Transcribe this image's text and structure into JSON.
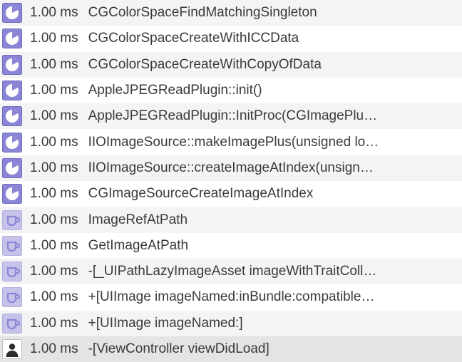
{
  "rows": [
    {
      "icon": "pie",
      "time": "1.00 ms",
      "symbol": "CGColorSpaceFindMatchingSingleton"
    },
    {
      "icon": "pie",
      "time": "1.00 ms",
      "symbol": "CGColorSpaceCreateWithICCData"
    },
    {
      "icon": "pie",
      "time": "1.00 ms",
      "symbol": "CGColorSpaceCreateWithCopyOfData"
    },
    {
      "icon": "pie",
      "time": "1.00 ms",
      "symbol": "AppleJPEGReadPlugin::init()"
    },
    {
      "icon": "pie",
      "time": "1.00 ms",
      "symbol": "AppleJPEGReadPlugin::InitProc(CGImagePlu…"
    },
    {
      "icon": "pie",
      "time": "1.00 ms",
      "symbol": "IIOImageSource::makeImagePlus(unsigned lo…"
    },
    {
      "icon": "pie",
      "time": "1.00 ms",
      "symbol": "IIOImageSource::createImageAtIndex(unsign…"
    },
    {
      "icon": "pie",
      "time": "1.00 ms",
      "symbol": "CGImageSourceCreateImageAtIndex"
    },
    {
      "icon": "cup",
      "time": "1.00 ms",
      "symbol": "ImageRefAtPath"
    },
    {
      "icon": "cup",
      "time": "1.00 ms",
      "symbol": "GetImageAtPath"
    },
    {
      "icon": "cup",
      "time": "1.00 ms",
      "symbol": "-[_UIPathLazyImageAsset imageWithTraitColl…"
    },
    {
      "icon": "cup",
      "time": "1.00 ms",
      "symbol": "+[UIImage imageNamed:inBundle:compatible…"
    },
    {
      "icon": "cup",
      "time": "1.00 ms",
      "symbol": "+[UIImage imageNamed:]"
    },
    {
      "icon": "user",
      "time": "1.00 ms",
      "symbol": "-[ViewController viewDidLoad]"
    }
  ],
  "colors": {
    "pie_fill": "#8a86d5",
    "pie_border": "#6f6bc2",
    "cup_fill": "#c6c3ea",
    "cup_stroke": "#8a86d5",
    "user_fill": "#2c2c2c"
  }
}
